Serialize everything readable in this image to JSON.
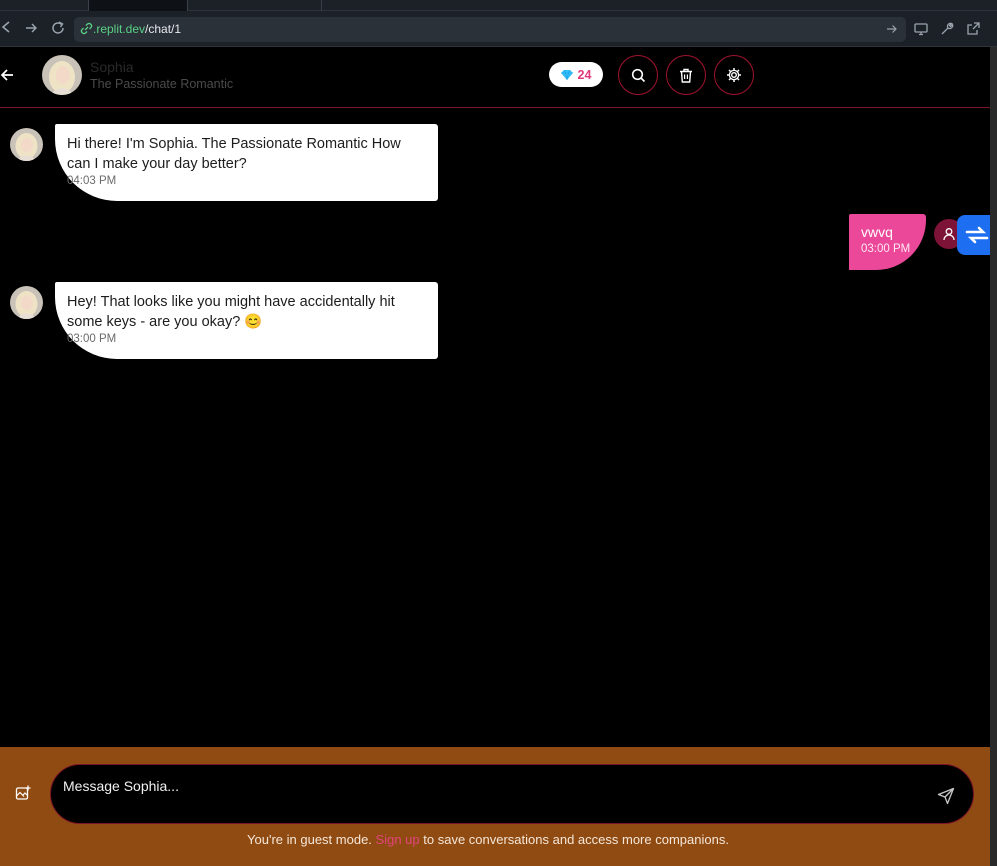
{
  "browser": {
    "url_host": ".replit.dev",
    "url_path": "/chat/1"
  },
  "header": {
    "name": "Sophia",
    "subtitle": "The Passionate Romantic",
    "gems": "24"
  },
  "messages": [
    {
      "sender": "bot",
      "text": "Hi there! I'm Sophia. The Passionate Romantic How can I make your day better?",
      "time": "04:03 PM"
    },
    {
      "sender": "user",
      "text": "vwvq",
      "time": "03:00 PM"
    },
    {
      "sender": "bot",
      "text": "Hey! That looks like you might have accidentally hit some keys - are you okay? 😊",
      "time": "03:00 PM"
    }
  ],
  "composer": {
    "placeholder": "Message Sophia..."
  },
  "footer": {
    "guest_prefix": "You're in guest mode.",
    "signup_link": "Sign up",
    "guest_suffix": "to save conversations and access more companions."
  },
  "colors": {
    "accent": "#ec4899",
    "border": "#a3142f",
    "footer_bg": "#8f4b12",
    "widget": "#1d6ef0"
  },
  "icons": {
    "back": "arrow-left-icon",
    "gem": "diamond-icon",
    "search": "search-icon",
    "delete": "trash-icon",
    "settings": "gear-icon",
    "attach": "image-plus-icon",
    "send": "send-icon"
  }
}
